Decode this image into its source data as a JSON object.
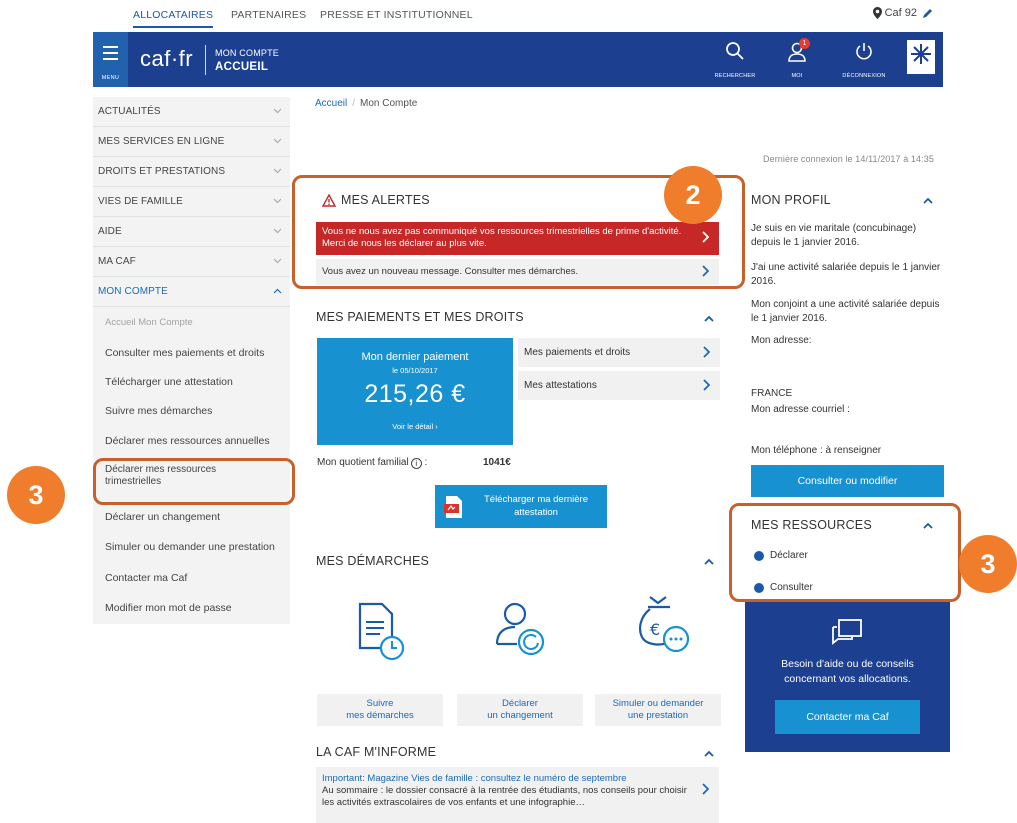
{
  "top_tabs": {
    "allocataires": "ALLOCATAIRES",
    "partenaires": "PARTENAIRES",
    "presse": "PRESSE ET INSTITUTIONNEL",
    "location": "Caf 92"
  },
  "header": {
    "menu_label": "MENU",
    "logo": "caf·fr",
    "line1": "MON COMPTE",
    "line2": "ACCUEIL",
    "search_label": "RECHERCHER",
    "user_label": "MOI",
    "user_badge": "1",
    "logout_label": "DÉCONNEXION"
  },
  "sidebar": {
    "items": [
      {
        "label": "ACTUALITÉS"
      },
      {
        "label": "MES SERVICES EN LIGNE"
      },
      {
        "label": "DROITS ET PRESTATIONS"
      },
      {
        "label": "VIES DE FAMILLE"
      },
      {
        "label": "AIDE"
      },
      {
        "label": "MA CAF"
      },
      {
        "label": "MON COMPTE"
      }
    ],
    "sub": [
      {
        "label": "Accueil Mon Compte"
      },
      {
        "label": "Consulter mes paiements et droits"
      },
      {
        "label": "Télécharger une attestation"
      },
      {
        "label": "Suivre mes démarches"
      },
      {
        "label": "Déclarer mes ressources annuelles"
      },
      {
        "label": "Déclarer mes ressources trimestrielles"
      },
      {
        "label": "Déclarer un changement"
      },
      {
        "label": "Simuler ou demander une prestation"
      },
      {
        "label": "Contacter ma Caf"
      },
      {
        "label": "Modifier mon mot de passe"
      }
    ]
  },
  "breadcrumb": {
    "home": "Accueil",
    "sep": "/",
    "current": "Mon Compte"
  },
  "last_login": "Dernière connexion le 14/11/2017 à 14:35",
  "alerts": {
    "title": "MES ALERTES",
    "red": "Vous ne nous avez pas communiqué vos ressources trimestrielles de prime d'activité. Merci de nous les déclarer au plus vite.",
    "grey": "Vous avez un nouveau message. Consulter mes démarches."
  },
  "payments": {
    "title": "MES PAIEMENTS ET MES DROITS",
    "last_title": "Mon dernier paiement",
    "last_date": "le 05/10/2017",
    "amount": "215,26 €",
    "detail": "Voir le détail",
    "link1": "Mes paiements et droits",
    "link2": "Mes attestations",
    "quotient_label": "Mon quotient familial",
    "quotient_value": "1041€",
    "download": "Télécharger ma dernière attestation"
  },
  "demarches": {
    "title": "MES DÉMARCHES",
    "btn1_l1": "Suivre",
    "btn1_l2": "mes démarches",
    "btn2_l1": "Déclarer",
    "btn2_l2": "un changement",
    "btn3_l1": "Simuler ou demander",
    "btn3_l2": "une prestation"
  },
  "informe": {
    "title": "LA CAF M'INFORME",
    "headline": "Important: Magazine Vies de famille : consultez le numéro de septembre",
    "body": "Au sommaire : le dossier consacré à la rentrée des étudiants, nos conseils pour choisir les activités extrascolaires de vos enfants et une infographie…"
  },
  "profile": {
    "title": "MON PROFIL",
    "p1": "Je suis en vie maritale (concubinage) depuis le 1 janvier 2016.",
    "p2": "J'ai une activité salariée depuis le 1 janvier 2016.",
    "p3": "Mon conjoint a une activité salariée depuis le 1 janvier 2016.",
    "p4": "Mon adresse:",
    "p5": "FRANCE",
    "p6": "Mon adresse courriel :",
    "p7": "Mon téléphone : à renseigner",
    "button": "Consulter ou modifier"
  },
  "resources": {
    "title": "MES RESSOURCES",
    "declare": "Déclarer",
    "consult": "Consulter"
  },
  "help": {
    "text": "Besoin d'aide ou de conseils concernant vos allocations.",
    "button": "Contacter ma Caf"
  },
  "annotations": {
    "n2": "2",
    "n3_left": "3",
    "n3_right": "3"
  },
  "colors": {
    "header": "#1d3f8f",
    "accent": "#1891d0",
    "alert": "#c62828",
    "annotation": "#ef7d2c"
  }
}
